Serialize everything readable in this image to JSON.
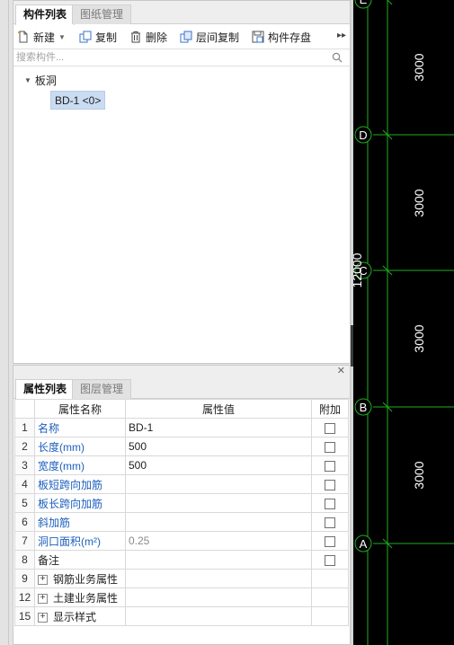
{
  "component_panel": {
    "tabs": [
      "构件列表",
      "图纸管理"
    ],
    "toolbar": {
      "new_label": "新建",
      "copy_label": "复制",
      "delete_label": "删除",
      "floor_copy_label": "层间复制",
      "save_label": "构件存盘"
    },
    "search_placeholder": "搜索构件...",
    "tree": {
      "category": "板洞",
      "item": "BD-1 <0>"
    }
  },
  "property_panel": {
    "tabs": [
      "属性列表",
      "图层管理"
    ],
    "columns": {
      "name": "属性名称",
      "value": "属性值",
      "extra": "附加"
    },
    "rows": [
      {
        "num": "1",
        "name": "名称",
        "value": "BD-1"
      },
      {
        "num": "2",
        "name": "长度(mm)",
        "value": "500"
      },
      {
        "num": "3",
        "name": "宽度(mm)",
        "value": "500"
      },
      {
        "num": "4",
        "name": "板短跨向加筋",
        "value": ""
      },
      {
        "num": "5",
        "name": "板长跨向加筋",
        "value": ""
      },
      {
        "num": "6",
        "name": "斜加筋",
        "value": ""
      },
      {
        "num": "7",
        "name": "洞口面积(m²)",
        "value": "0.25"
      },
      {
        "num": "8",
        "name": "备注",
        "value": ""
      }
    ],
    "groups": [
      {
        "num": "9",
        "name": "钢筋业务属性"
      },
      {
        "num": "12",
        "name": "土建业务属性"
      },
      {
        "num": "15",
        "name": "显示样式"
      }
    ]
  },
  "canvas": {
    "axis_labels": [
      "E",
      "D",
      "C",
      "B",
      "A"
    ],
    "dimensions": [
      "3000",
      "3000",
      "3000",
      "3000"
    ],
    "total_dimension": "12000",
    "colors": {
      "background": "#000000",
      "grid": "#1fae1f",
      "text": "#ffffff"
    }
  }
}
